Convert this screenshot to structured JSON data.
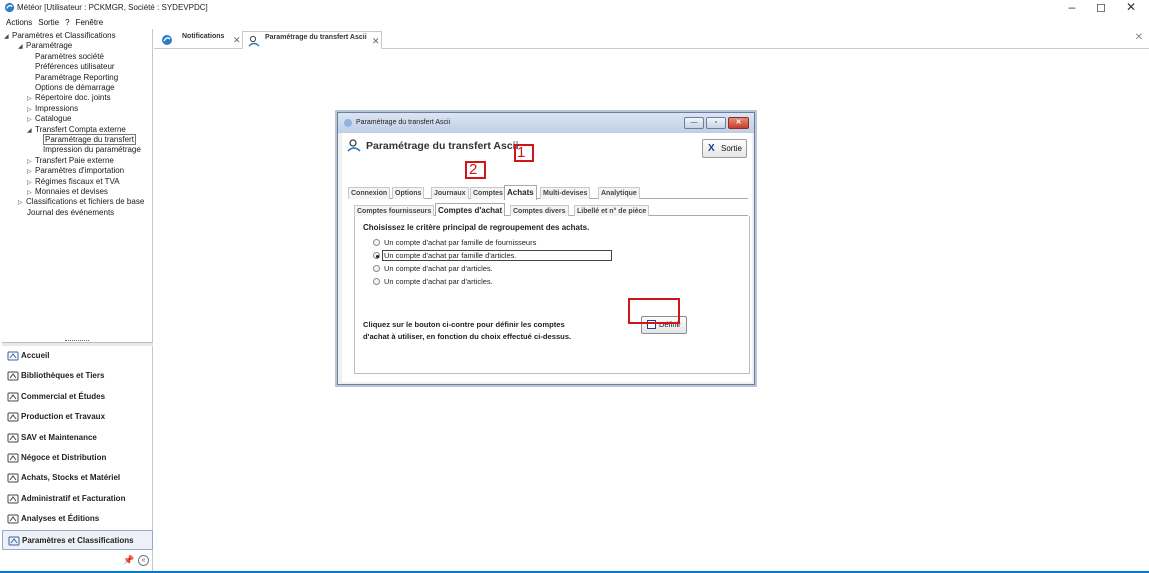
{
  "window": {
    "title": "Météor [Utilisateur : PCKMGR, Société : SYDEVPDC]",
    "controls": [
      "–",
      "◻",
      "✕"
    ]
  },
  "menu": [
    "Actions",
    "Sortie",
    "?",
    "Fenêtre"
  ],
  "tree": [
    {
      "label": "Paramètres et Classifications",
      "arrow": "◢",
      "level": 0
    },
    {
      "label": "Paramétrage",
      "arrow": "◢",
      "level": 1
    },
    {
      "label": "Paramètres société",
      "arrow": "",
      "level": 2
    },
    {
      "label": "Préférences utilisateur",
      "arrow": "",
      "level": 2
    },
    {
      "label": "Paramétrage Reporting",
      "arrow": "",
      "level": 2
    },
    {
      "label": "Options de démarrage",
      "arrow": "",
      "level": 2
    },
    {
      "label": "Répertoire doc. joints",
      "arrow": "▷",
      "level": 2
    },
    {
      "label": "Impressions",
      "arrow": "▷",
      "level": 2
    },
    {
      "label": "Catalogue",
      "arrow": "▷",
      "level": 2
    },
    {
      "label": "Transfert Compta externe",
      "arrow": "◢",
      "level": 2
    },
    {
      "label": "Paramétrage du transfert",
      "arrow": "",
      "level": 3,
      "selected": true
    },
    {
      "label": "Impression du paramétrage",
      "arrow": "",
      "level": 3
    },
    {
      "label": "Transfert Paie externe",
      "arrow": "▷",
      "level": 2
    },
    {
      "label": "Paramètres d'importation",
      "arrow": "▷",
      "level": 2
    },
    {
      "label": "Régimes fiscaux et TVA",
      "arrow": "▷",
      "level": 2
    },
    {
      "label": "Monnaies et devises",
      "arrow": "▷",
      "level": 2
    },
    {
      "label": "Classifications et fichiers de base",
      "arrow": "▷",
      "level": 1
    },
    {
      "label": "Journal des événements",
      "arrow": "",
      "level": 1
    }
  ],
  "nav": [
    {
      "label": "Accueil",
      "icon": "home-icon"
    },
    {
      "label": "Bibliothèques et Tiers",
      "icon": "library-icon"
    },
    {
      "label": "Commercial et Études",
      "icon": "commercial-icon"
    },
    {
      "label": "Production et Travaux",
      "icon": "production-icon"
    },
    {
      "label": "SAV et Maintenance",
      "icon": "maintenance-icon"
    },
    {
      "label": "Négoce et Distribution",
      "icon": "trade-icon"
    },
    {
      "label": "Achats, Stocks et Matériel",
      "icon": "cart-icon"
    },
    {
      "label": "Administratif et Facturation",
      "icon": "billing-icon"
    },
    {
      "label": "Analyses et Éditions",
      "icon": "analysis-icon"
    },
    {
      "label": "Paramètres et Classifications",
      "icon": "settings-icon",
      "active": true
    }
  ],
  "nav_footer": {
    "pin": "📌",
    "collapse": "«"
  },
  "tabs": [
    {
      "label": "Notifications"
    },
    {
      "label": "Paramétrage du transfert Ascii",
      "active": true
    }
  ],
  "dialog": {
    "title": "Paramétrage du transfert Ascii",
    "header": "Paramétrage du transfert Ascii",
    "sortie_label": "Sortie",
    "tabs": [
      "Connexion",
      "Options",
      "Journaux",
      "Comptes",
      "Achats",
      "Multi-devises",
      "Analytique"
    ],
    "active_tab": "Achats",
    "subtabs": [
      "Comptes fournisseurs",
      "Comptes d'achat",
      "Comptes divers",
      "Libellé et n° de pièce"
    ],
    "active_subtab": "Comptes d'achat",
    "question": "Choisissez le critère principal de regroupement des achats.",
    "options": [
      {
        "label": "Un compte d'achat par famille de fournisseurs",
        "checked": false
      },
      {
        "label": "Un compte d'achat par famille d'articles.",
        "checked": true
      },
      {
        "label": "Un compte d'achat par  d'articles.",
        "checked": false
      },
      {
        "label": "Un compte d'achat par  d'articles.",
        "checked": false
      }
    ],
    "instruction_line1": "Cliquez sur le bouton ci-contre pour définir les comptes",
    "instruction_line2": "d'achat à utiliser, en fonction du choix effectué ci-dessus.",
    "definir_label": "Définir"
  },
  "annotations": {
    "marker1": "1",
    "marker2": "2",
    "color": "#d0161a"
  }
}
